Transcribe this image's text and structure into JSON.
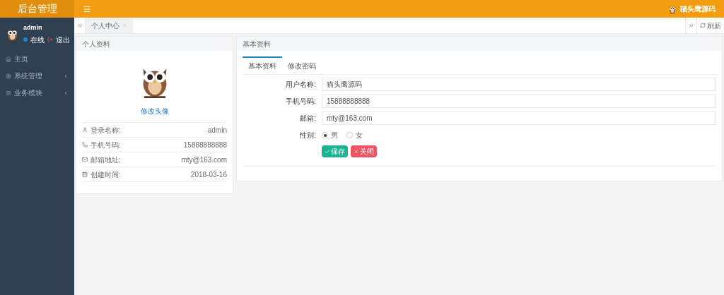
{
  "app": {
    "title": "后台管理"
  },
  "user": {
    "name": "admin",
    "status": "在线",
    "logout": "退出"
  },
  "sidebar": {
    "items": [
      {
        "label": "主页",
        "expandable": false
      },
      {
        "label": "系统管理",
        "expandable": true
      },
      {
        "label": "业务模块",
        "expandable": true
      }
    ]
  },
  "topbar": {
    "user_name": "猫头鹰源码"
  },
  "tabs": [
    {
      "label": "个人中心",
      "selected": true
    }
  ],
  "refresh": "刷新",
  "profile_card": {
    "title": "个人资料",
    "avatar_link": "修改头像",
    "rows": [
      {
        "label": "登录名称:",
        "value": "admin"
      },
      {
        "label": "手机号码:",
        "value": "15888888888"
      },
      {
        "label": "邮箱地址:",
        "value": "mty@163.com"
      },
      {
        "label": "创建时间:",
        "value": "2018-03-16"
      }
    ]
  },
  "basic_card": {
    "title": "基本资料",
    "tabs": [
      {
        "label": "基本资料",
        "selected": true
      },
      {
        "label": "修改密码",
        "selected": false
      }
    ],
    "fields": [
      {
        "label": "用户名称:",
        "value": "猫头鹰源码"
      },
      {
        "label": "手机号码:",
        "value": "15888888888"
      },
      {
        "label": "邮箱:",
        "value": "mty@163.com"
      }
    ],
    "gender": {
      "label": "性别:",
      "options": [
        {
          "label": "男",
          "selected": true
        },
        {
          "label": "女",
          "selected": false
        }
      ]
    },
    "buttons": [
      {
        "label": "保存",
        "kind": "save"
      },
      {
        "label": "关闭",
        "kind": "close"
      }
    ]
  }
}
